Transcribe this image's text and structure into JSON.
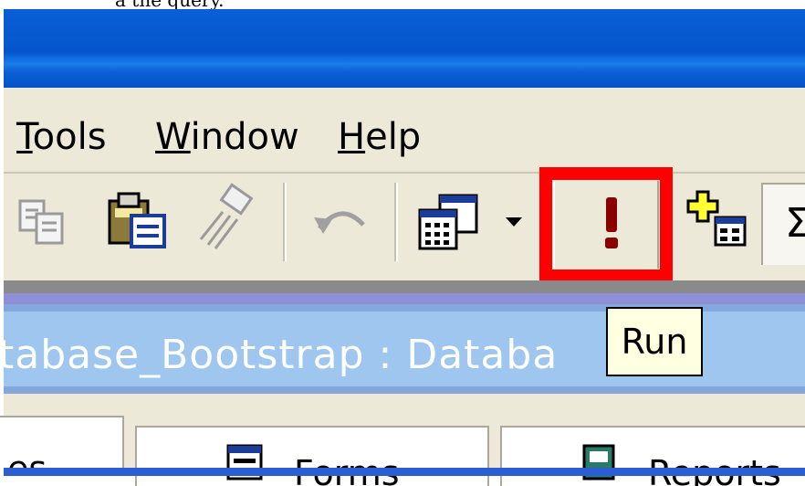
{
  "caption_fragment": "a the query.",
  "menu": {
    "tools": {
      "label_pre": "",
      "hotkey": "T",
      "label_post": "ools"
    },
    "window": {
      "label_pre": "",
      "hotkey": "W",
      "label_post": "indow"
    },
    "help": {
      "label_pre": "",
      "hotkey": "H",
      "label_post": "elp"
    }
  },
  "toolbar": {
    "icons": [
      "copy-icon",
      "paste-icon",
      "format-painter-icon",
      "undo-icon",
      "view-icon",
      "view-dropdown-icon",
      "run-icon",
      "new-object-icon",
      "totals-icon"
    ],
    "sigma_glyph": "Σ"
  },
  "tooltip": {
    "text": "Run"
  },
  "database_window": {
    "title": "tabase_Bootstrap : Databa"
  },
  "tabs": [
    {
      "label": "es"
    },
    {
      "label": "Forms"
    },
    {
      "label": "Reports"
    }
  ],
  "colors": {
    "title_bar": "#0556cc",
    "highlight": "#ff0000",
    "run_icon": "#8b0000",
    "tooltip_bg": "#ffffe1"
  }
}
